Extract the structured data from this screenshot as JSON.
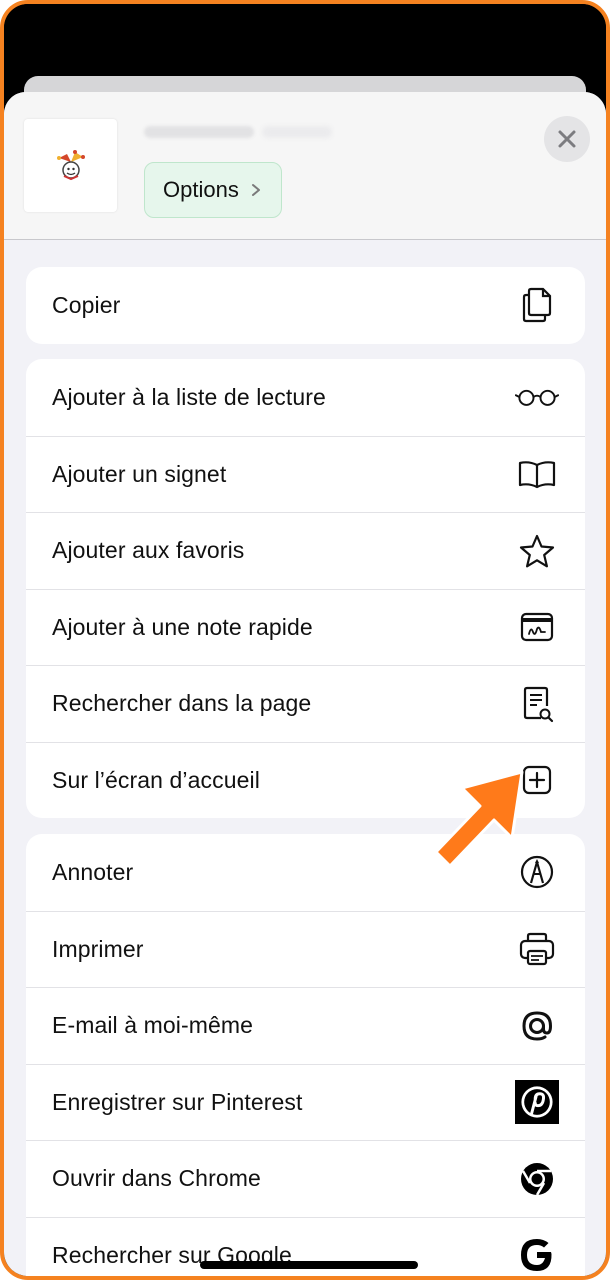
{
  "colors": {
    "frame_border": "#f58220",
    "arrow": "#ff7a1a",
    "options_bg": "#e6f6ec"
  },
  "header": {
    "options_label": "Options",
    "close_icon": "close-icon",
    "thumbnail_icon": "jester-logo"
  },
  "groups": [
    {
      "items": [
        {
          "label": "Copier",
          "icon": "copy-icon"
        }
      ]
    },
    {
      "items": [
        {
          "label": "Ajouter à la liste de lecture",
          "icon": "glasses-icon"
        },
        {
          "label": "Ajouter un signet",
          "icon": "book-icon"
        },
        {
          "label": "Ajouter aux favoris",
          "icon": "star-icon"
        },
        {
          "label": "Ajouter à une note rapide",
          "icon": "quick-note-icon"
        },
        {
          "label": "Rechercher dans la page",
          "icon": "find-in-page-icon"
        },
        {
          "label": "Sur l’écran d’accueil",
          "icon": "add-square-icon"
        }
      ]
    },
    {
      "items": [
        {
          "label": "Annoter",
          "icon": "markup-icon"
        },
        {
          "label": "Imprimer",
          "icon": "printer-icon"
        },
        {
          "label": "E-mail à moi-même",
          "icon": "at-icon"
        },
        {
          "label": "Enregistrer sur Pinterest",
          "icon": "pinterest-icon"
        },
        {
          "label": "Ouvrir dans Chrome",
          "icon": "chrome-icon"
        },
        {
          "label": "Rechercher sur Google",
          "icon": "google-icon"
        }
      ]
    }
  ]
}
